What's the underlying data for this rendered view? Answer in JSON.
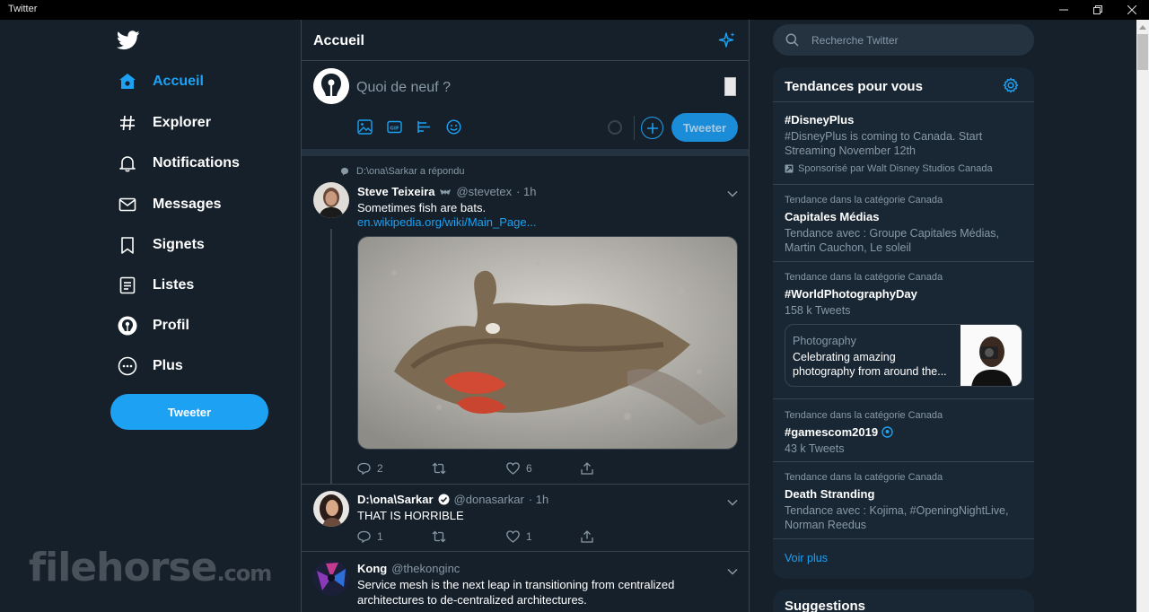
{
  "window": {
    "title": "Twitter"
  },
  "sidebar": {
    "items": [
      {
        "label": "Accueil",
        "icon": "home-icon",
        "active": true
      },
      {
        "label": "Explorer",
        "icon": "hashtag-icon"
      },
      {
        "label": "Notifications",
        "icon": "bell-icon"
      },
      {
        "label": "Messages",
        "icon": "envelope-icon"
      },
      {
        "label": "Signets",
        "icon": "bookmark-icon"
      },
      {
        "label": "Listes",
        "icon": "list-icon"
      },
      {
        "label": "Profil",
        "icon": "profile-icon"
      },
      {
        "label": "Plus",
        "icon": "more-icon"
      }
    ],
    "tweet_button": "Tweeter"
  },
  "watermark": {
    "main": "filehorse",
    "suffix": ".com"
  },
  "main": {
    "title": "Accueil",
    "compose": {
      "placeholder": "Quoi de neuf ?",
      "button": "Tweeter"
    },
    "replied_note": "D:\\ona\\Sarkar a répondu",
    "tweets": [
      {
        "name": "Steve Teixeira",
        "handle": "@stevetex",
        "time": "· 1h",
        "text": "Sometimes fish are bats.",
        "link": "en.wikipedia.org/wiki/Main_Page...",
        "replies": "2",
        "likes": "6"
      },
      {
        "name": "D:\\ona\\Sarkar",
        "handle": "@donasarkar",
        "time": "· 1h",
        "text": "THAT IS HORRIBLE",
        "replies": "1",
        "likes": "1"
      },
      {
        "name": "Kong",
        "handle": "@thekonginc",
        "text": "Service mesh is the next leap in transitioning from centralized architectures to de-centralized architectures."
      }
    ]
  },
  "search": {
    "placeholder": "Recherche Twitter"
  },
  "trends": {
    "title": "Tendances pour vous",
    "items": [
      {
        "title": "#DisneyPlus",
        "desc": "#DisneyPlus is coming to Canada. Start Streaming November 12th",
        "sponsor": "Sponsorisé par Walt Disney Studios Canada"
      },
      {
        "category": "Tendance dans la catégorie Canada",
        "title": "Capitales Médias",
        "desc": "Tendance avec : Groupe Capitales Médias, Martin Cauchon, Le soleil"
      },
      {
        "category": "Tendance dans la catégorie Canada",
        "title": "#WorldPhotographyDay",
        "count": "158 k Tweets",
        "card_title": "Photography",
        "card_desc": "Celebrating amazing photography from around the..."
      },
      {
        "category": "Tendance dans la catégorie Canada",
        "title": "#gamescom2019",
        "count": "43 k Tweets"
      },
      {
        "category": "Tendance dans la catégorie Canada",
        "title": "Death Stranding",
        "desc": "Tendance avec : Kojima, #OpeningNightLive, Norman Reedus"
      }
    ],
    "more": "Voir plus"
  },
  "suggestions": {
    "title": "Suggestions"
  },
  "colors": {
    "background": "#15202b",
    "accent": "#1da1f2",
    "card": "#192734",
    "border": "#38444d",
    "muted": "#8899a6"
  }
}
